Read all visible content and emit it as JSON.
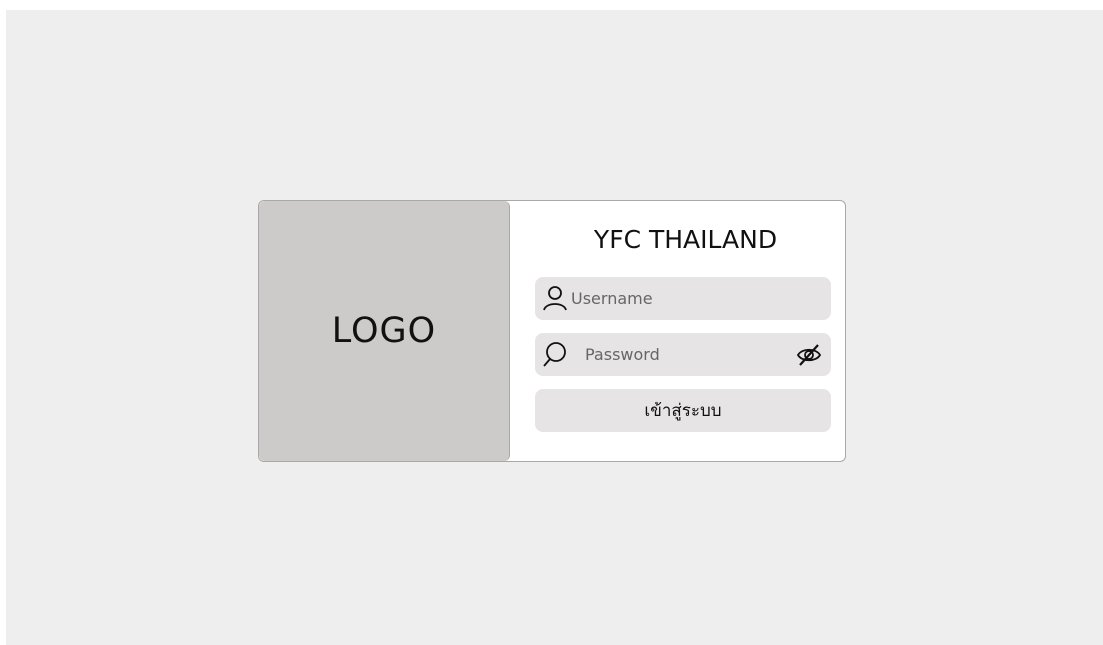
{
  "logo": {
    "text": "LOGO"
  },
  "title": "YFC THAILAND",
  "username": {
    "placeholder": "Username",
    "value": "",
    "icon": "user-icon"
  },
  "password": {
    "placeholder": "Password",
    "value": "",
    "icon": "search-icon",
    "toggle_icon": "eye-slash-icon"
  },
  "login": {
    "label": "เข้าสู่ระบบ"
  },
  "colors": {
    "background": "#eeeeee",
    "card": "#ffffff",
    "logo_panel": "#cccbca",
    "field": "#e6e4e4",
    "border": "#a8a8a8"
  }
}
